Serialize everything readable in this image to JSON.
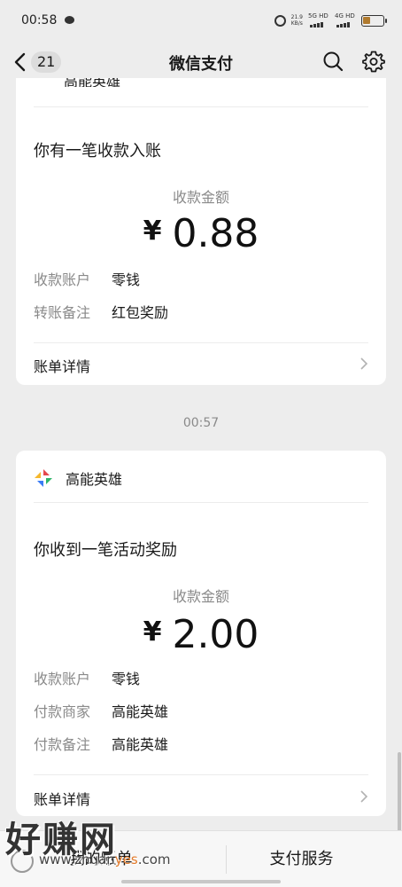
{
  "status_bar": {
    "time": "00:58",
    "net_speed_value": "21.9",
    "net_speed_unit": "KB/s",
    "signal_1": "5G HD",
    "signal_2": "4G HD",
    "battery_level": 0.4,
    "battery_color": "#b07a2e"
  },
  "nav": {
    "back_count": "21",
    "title": "微信支付",
    "search_icon": "search-icon",
    "settings_icon": "gear-icon"
  },
  "card1": {
    "merchant_partial": "高能英雄",
    "heading": "你有一笔收款入账",
    "amount_label": "收款金额",
    "currency": "¥",
    "amount": "0.88",
    "rows": [
      {
        "label": "收款账户",
        "value": "零钱"
      },
      {
        "label": "转账备注",
        "value": "红包奖励"
      }
    ],
    "detail_link": "账单详情"
  },
  "time_separator": "00:57",
  "card2": {
    "merchant": "高能英雄",
    "heading": "你收到一笔活动奖励",
    "amount_label": "收款金额",
    "currency": "¥",
    "amount": "2.00",
    "rows": [
      {
        "label": "收款账户",
        "value": "零钱"
      },
      {
        "label": "付款商家",
        "value": "高能英雄"
      },
      {
        "label": "付款备注",
        "value": "高能英雄"
      }
    ],
    "detail_link": "账单详情"
  },
  "bottom_bar": {
    "tab_left": "我的账单",
    "tab_right": "支付服务"
  },
  "watermark": {
    "main": "好赚网",
    "sub_prefix": "www.zhuan",
    "sub_highlight": "yes",
    "sub_suffix": ".com"
  },
  "colors": {
    "background": "#ededed",
    "card": "#ffffff",
    "secondary_text": "#8a8a8a",
    "logo_red": "#e5484d",
    "logo_yellow": "#f5b82e",
    "logo_green": "#2fb56a",
    "logo_blue": "#3a7bf5"
  }
}
